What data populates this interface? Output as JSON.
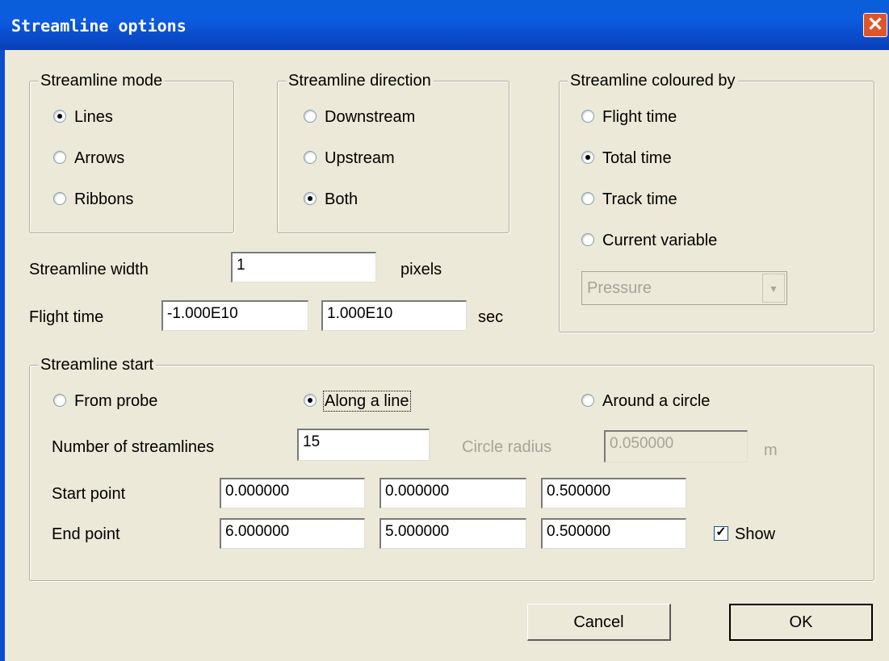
{
  "window": {
    "title": "Streamline options",
    "close_icon": "close-icon"
  },
  "mode": {
    "legend": "Streamline mode",
    "options": [
      {
        "label": "Lines",
        "selected": true
      },
      {
        "label": "Arrows",
        "selected": false
      },
      {
        "label": "Ribbons",
        "selected": false
      }
    ]
  },
  "direction": {
    "legend": "Streamline direction",
    "options": [
      {
        "label": "Downstream",
        "selected": false
      },
      {
        "label": "Upstream",
        "selected": false
      },
      {
        "label": "Both",
        "selected": true
      }
    ]
  },
  "coloured": {
    "legend": "Streamline coloured by",
    "options": [
      {
        "label": "Flight time",
        "selected": false
      },
      {
        "label": "Total time",
        "selected": true
      },
      {
        "label": "Track time",
        "selected": false
      },
      {
        "label": "Current variable",
        "selected": false
      }
    ],
    "variable_value": "Pressure"
  },
  "width": {
    "label": "Streamline width",
    "value": "1",
    "unit": "pixels"
  },
  "flight_time": {
    "label": "Flight time",
    "min": "-1.000E10",
    "max": "1.000E10",
    "unit": "sec"
  },
  "start": {
    "legend": "Streamline start",
    "options": [
      {
        "label": "From probe",
        "selected": false
      },
      {
        "label": "Along a line",
        "selected": true
      },
      {
        "label": "Around a circle",
        "selected": false
      }
    ],
    "num_label": "Number of streamlines",
    "num_value": "15",
    "radius_label": "Circle radius",
    "radius_value": "0.050000",
    "radius_unit": "m",
    "start_label": "Start point",
    "start_values": [
      "0.000000",
      "0.000000",
      "0.500000"
    ],
    "end_label": "End point",
    "end_values": [
      "6.000000",
      "5.000000",
      "0.500000"
    ],
    "show_label": "Show",
    "show_checked": true
  },
  "buttons": {
    "cancel": "Cancel",
    "ok": "OK"
  }
}
